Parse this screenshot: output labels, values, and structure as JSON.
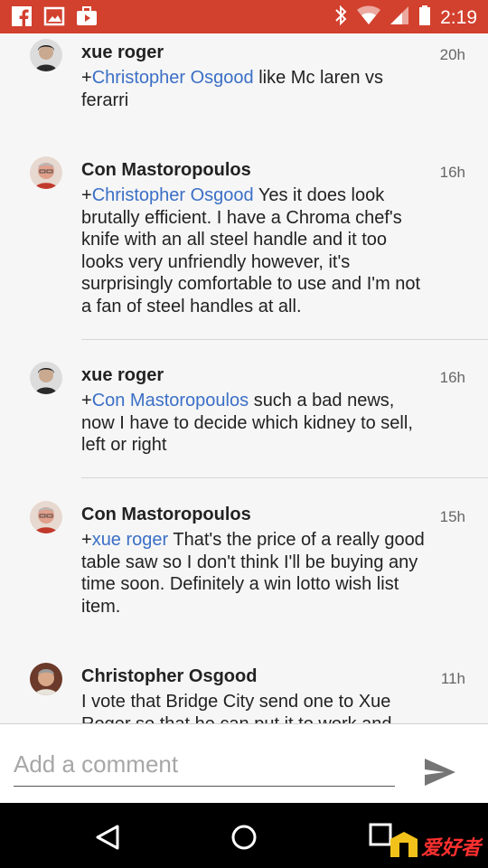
{
  "status_bar": {
    "time": "2:19",
    "left_icons": [
      "facebook-icon",
      "image-icon",
      "briefcase-icon"
    ],
    "right_icons": [
      "bluetooth-icon",
      "wifi-icon",
      "signal-icon",
      "battery-icon"
    ],
    "color": "#d2402e"
  },
  "comments": [
    {
      "author": "xue roger",
      "time": "20h",
      "mention_prefix": "+",
      "mention": "Christopher Osgood",
      "text": "like Mc laren vs ferarri",
      "avatar": "avatar-xue"
    },
    {
      "author": "Con Mastoropoulos",
      "time": "16h",
      "mention_prefix": "+",
      "mention": "Christopher Osgood",
      "text": "Yes it does look brutally efficient. I have a Chroma chef's knife with an all steel handle and it too looks very unfriendly however, it's surprisingly comfortable to use and I'm not a fan of steel handles at all.",
      "avatar": "avatar-con"
    },
    {
      "author": "xue roger",
      "time": "16h",
      "mention_prefix": "+",
      "mention": "Con Mastoropoulos",
      "text": "such a bad news, now I have to decide which kidney to sell, left or right",
      "avatar": "avatar-xue"
    },
    {
      "author": "Con Mastoropoulos",
      "time": "15h",
      "mention_prefix": "+",
      "mention": "xue roger",
      "text": "That's the price of a really good table saw so I don't think I'll be buying any time soon. Definitely a win lotto wish list item.",
      "avatar": "avatar-con"
    },
    {
      "author": "Christopher Osgood",
      "time": "11h",
      "text": "I vote that Bridge City send one to Xue Roger so that he can put it to work and",
      "avatar": "avatar-chris"
    }
  ],
  "comment_input": {
    "placeholder": "Add a comment",
    "value": ""
  },
  "send_icon": "send-icon",
  "nav": {
    "back_icon": "back-icon",
    "home_icon": "home-icon",
    "recents_icon": "recents-icon"
  },
  "watermark": {
    "text": "爱好者"
  }
}
